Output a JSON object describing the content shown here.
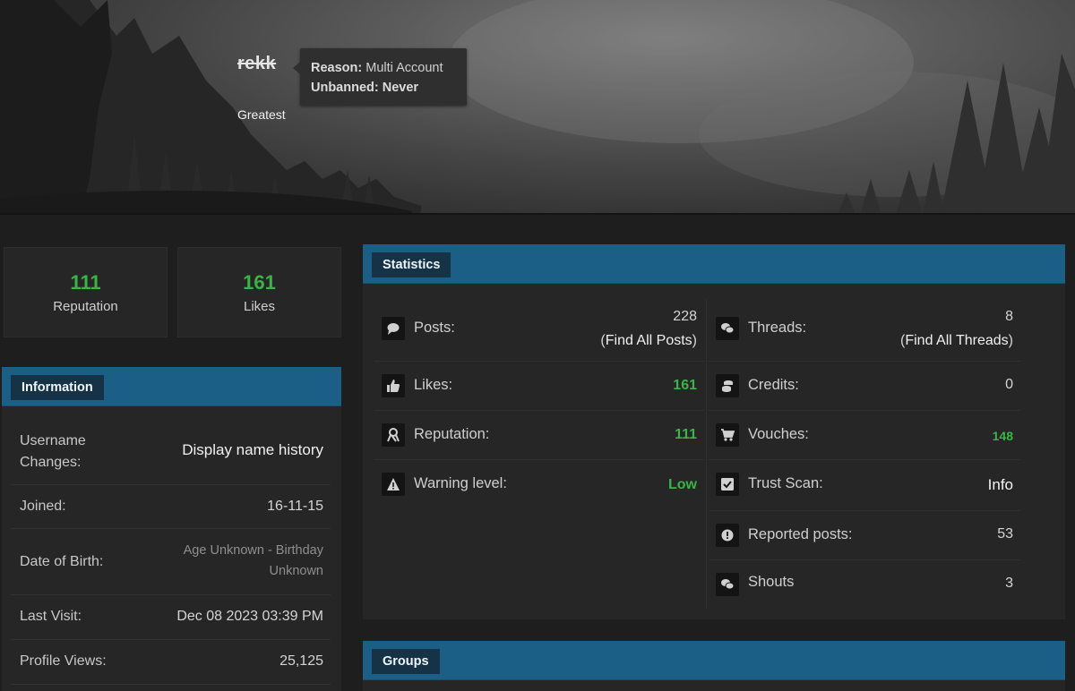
{
  "profile": {
    "username": "rekk",
    "user_title": "Greatest",
    "ban": {
      "reason_label": "Reason:",
      "reason_value": "Multi Account",
      "unbanned_label": "Unbanned:",
      "unbanned_value": "Never"
    }
  },
  "summary": {
    "reputation": {
      "value": "111",
      "label": "Reputation"
    },
    "likes": {
      "value": "161",
      "label": "Likes"
    }
  },
  "information": {
    "title": "Information",
    "rows": [
      {
        "label": "Username Changes:",
        "value": "Display name history"
      },
      {
        "label": "Joined:",
        "value": "16-11-15"
      },
      {
        "label": "Date of Birth:",
        "value": "Age Unknown - Birthday Unknown"
      },
      {
        "label": "Last Visit:",
        "value": "Dec 08 2023 03:39 PM"
      },
      {
        "label": "Profile Views:",
        "value": "25,125"
      }
    ]
  },
  "statistics": {
    "title": "Statistics",
    "posts": {
      "label": "Posts:",
      "value": "228",
      "find_prefix": "(",
      "find_label": "Find All Posts",
      "find_suffix": ")"
    },
    "threads": {
      "label": "Threads:",
      "value": "8",
      "find_prefix": "(",
      "find_label": "Find All Threads",
      "find_suffix": ")"
    },
    "likes": {
      "label": "Likes:",
      "value": "161"
    },
    "credits": {
      "label": "Credits:",
      "value": "0"
    },
    "reputation": {
      "label": "Reputation:",
      "value": "111"
    },
    "vouches": {
      "label": "Vouches:",
      "value": "148"
    },
    "warning": {
      "label": "Warning level:",
      "value": "Low"
    },
    "trust": {
      "label": "Trust Scan:",
      "value": "Info"
    },
    "reported": {
      "label": "Reported posts:",
      "value": "53"
    },
    "shouts": {
      "label": "Shouts",
      "value": "3"
    }
  },
  "groups": {
    "title": "Groups"
  },
  "colors": {
    "accent": "#1b5f86",
    "tab": "#163247",
    "positive": "#38b545",
    "background": "#1e1e1e"
  }
}
